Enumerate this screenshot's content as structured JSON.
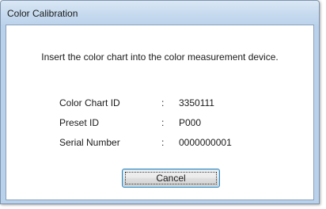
{
  "window": {
    "title": "Color Calibration"
  },
  "dialog": {
    "instruction": "Insert the color chart into the color measurement device.",
    "separator": ":",
    "fields": [
      {
        "label": "Color Chart ID",
        "value": "3350111"
      },
      {
        "label": "Preset ID",
        "value": "P000"
      },
      {
        "label": "Serial Number",
        "value": "0000000001"
      }
    ],
    "cancel_label": "Cancel"
  },
  "colors": {
    "frame": "#b9d1ea",
    "button_border": "#3c7fb1",
    "background": "#ffffff"
  }
}
